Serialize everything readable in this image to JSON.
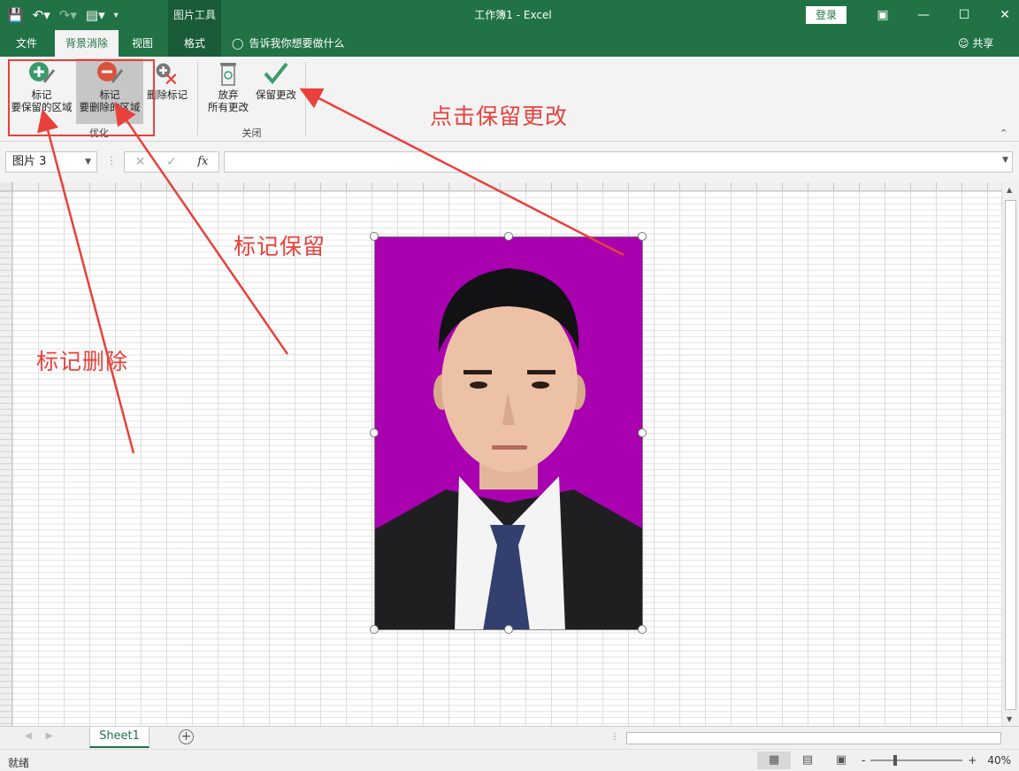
{
  "titlebar": {
    "context_tool_title": "图片工具",
    "window_title": "工作簿1  -  Excel",
    "login_label": "登录",
    "brand_color": "#217346"
  },
  "tabs": {
    "file": "文件",
    "background_removal": "背景消除",
    "view": "视图",
    "format": "格式",
    "tell_me": "告诉我你想要做什么",
    "share": "共享"
  },
  "ribbon": {
    "mark_keep": "标记\n要保留的区域",
    "mark_keep_line1": "标记",
    "mark_keep_line2": "要保留的区域",
    "mark_remove_line1": "标记",
    "mark_remove_line2": "要删除的区域",
    "delete_mark": "删除标记",
    "group_refine": "优化",
    "discard_line1": "放弃",
    "discard_line2": "所有更改",
    "keep_changes": "保留更改",
    "group_close": "关闭"
  },
  "formula_bar": {
    "name_box": "图片 3",
    "cancel_glyph": "✕",
    "enter_glyph": "✓",
    "fx_glyph": "fx",
    "formula_value": ""
  },
  "sheet": {
    "picture_background_color": "#a900b0"
  },
  "sheet_tabs": {
    "active_sheet": "Sheet1",
    "add_sheet_glyph": "+"
  },
  "status": {
    "ready": "就绪",
    "zoom_minus": "-",
    "zoom_plus": "+",
    "zoom_level": "40%"
  },
  "annotations": {
    "keep_changes_note": "点击保留更改",
    "mark_keep_note": "标记保留",
    "mark_remove_note": "标记删除",
    "color": "#e8413c"
  }
}
